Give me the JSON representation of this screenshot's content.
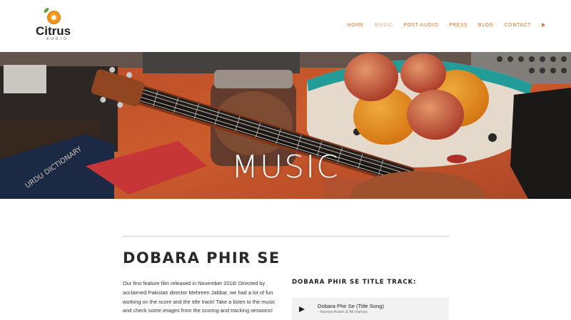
{
  "brand": {
    "name": "Citrus",
    "sub": "AUDIO"
  },
  "nav": {
    "items": [
      {
        "label": "HOME"
      },
      {
        "label": "MUSIC"
      },
      {
        "label": "POST-AUDIO"
      },
      {
        "label": "PRESS"
      },
      {
        "label": "BLOG"
      },
      {
        "label": "CONTACT"
      }
    ],
    "active": "MUSIC"
  },
  "hero": {
    "title": "MUSIC"
  },
  "project": {
    "title": "DOBARA PHIR SE",
    "intro": "Our first feature film released in November 2016! Directed by acclaimed Pakistan director Mehreen Jabbar, we had a lot of fun working on the score and the title track! Take a listen to the music and check some images from the scoring and tracking sessions!"
  },
  "track_section": {
    "heading": "DOBARA PHIR SE TITLE TRACK:",
    "player": {
      "song": "Dobara Phir Se (Title Song)",
      "artist": "- Haniya Aslam & Ali Hamza"
    }
  },
  "colors": {
    "nav_text": "#d57a3b",
    "nav_active": "#e3ad87",
    "logo_orange": "#f39a1f"
  },
  "icons": {
    "logo": "orange-fruit-icon",
    "nav_play": "play-icon",
    "player_play": "play-icon"
  }
}
